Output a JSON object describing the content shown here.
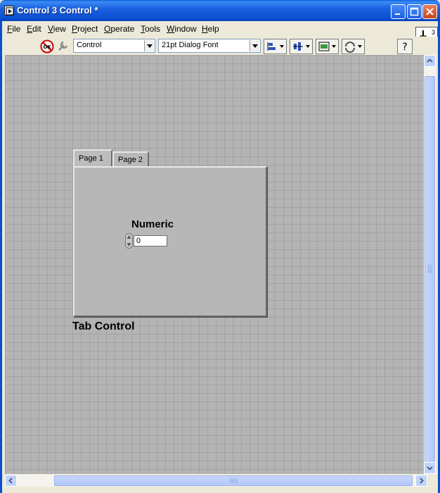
{
  "window": {
    "title": "Control 3 Control *"
  },
  "menu": {
    "items": [
      "File",
      "Edit",
      "View",
      "Project",
      "Operate",
      "Tools",
      "Window",
      "Help"
    ],
    "underline": [
      "F",
      "E",
      "V",
      "P",
      "O",
      "T",
      "W",
      "H"
    ]
  },
  "toolbar": {
    "control_type": "Control",
    "font": "21pt Dialog Font"
  },
  "run_icon": {
    "number": "3"
  },
  "tab_control": {
    "label": "Tab Control",
    "tabs": [
      "Page 1",
      "Page 2"
    ],
    "active_tab": 0
  },
  "numeric": {
    "label": "Numeric",
    "value": "0"
  }
}
